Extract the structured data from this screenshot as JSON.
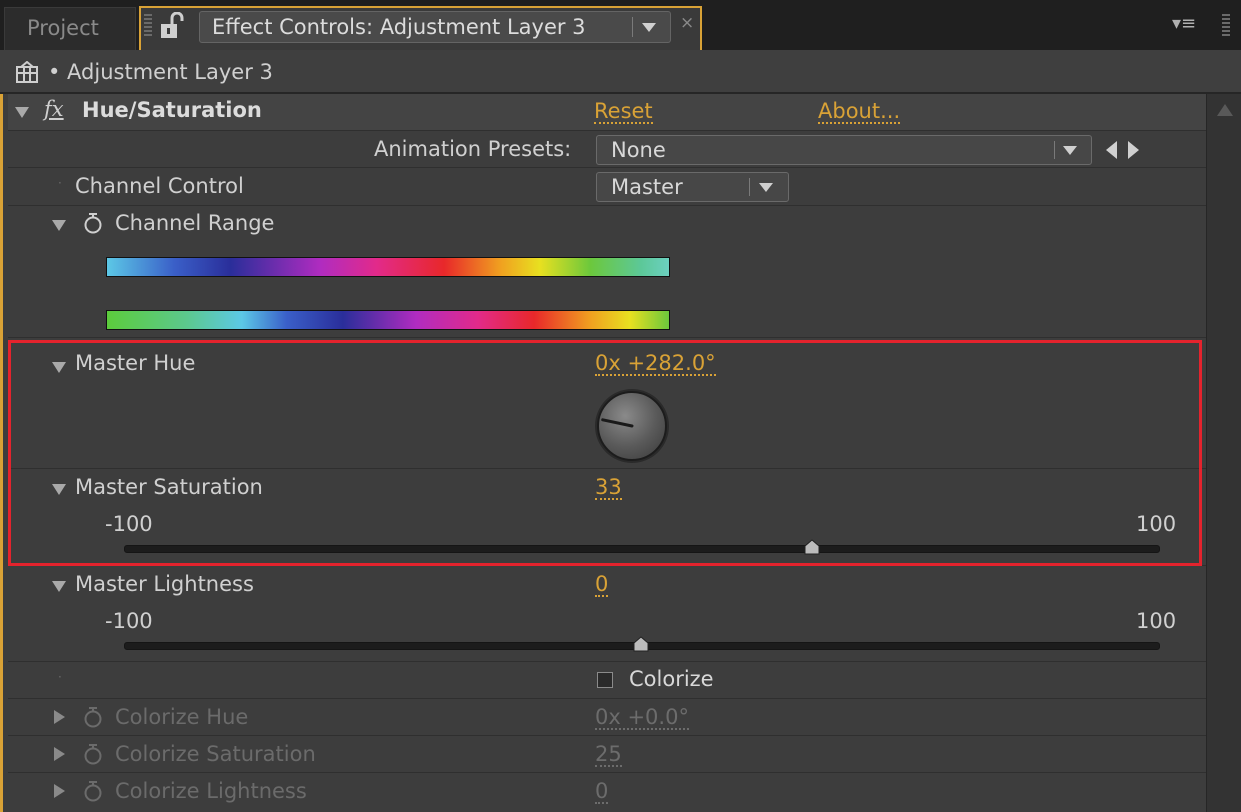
{
  "tabs": {
    "project": "Project",
    "effect_controls": "Effect Controls: Adjustment Layer 3",
    "close": "×",
    "menu": "▾≡"
  },
  "layer": {
    "name": "• Adjustment Layer 3"
  },
  "effect": {
    "fx": "fx",
    "name": "Hue/Saturation",
    "reset": "Reset",
    "about": "About...",
    "animation_presets_label": "Animation Presets:",
    "animation_presets_value": "None",
    "channel_control_label": "Channel Control",
    "channel_control_value": "Master",
    "channel_range_label": "Channel Range",
    "master_hue_label": "Master Hue",
    "master_hue_value": "0x +282.0°",
    "master_hue_degrees": 282,
    "master_saturation_label": "Master Saturation",
    "master_saturation_value": "33",
    "master_saturation": 33,
    "master_lightness_label": "Master Lightness",
    "master_lightness_value": "0",
    "master_lightness": 0,
    "slider_min": "-100",
    "slider_max": "100",
    "colorize_label": "Colorize",
    "colorize_checked": false,
    "colorize_hue_label": "Colorize Hue",
    "colorize_hue_value": "0x +0.0°",
    "colorize_saturation_label": "Colorize Saturation",
    "colorize_saturation_value": "25",
    "colorize_lightness_label": "Colorize Lightness",
    "colorize_lightness_value": "0"
  },
  "colors": {
    "accent": "#d9a236",
    "highlight": "#e4232d",
    "panel": "#3d3d3d"
  }
}
